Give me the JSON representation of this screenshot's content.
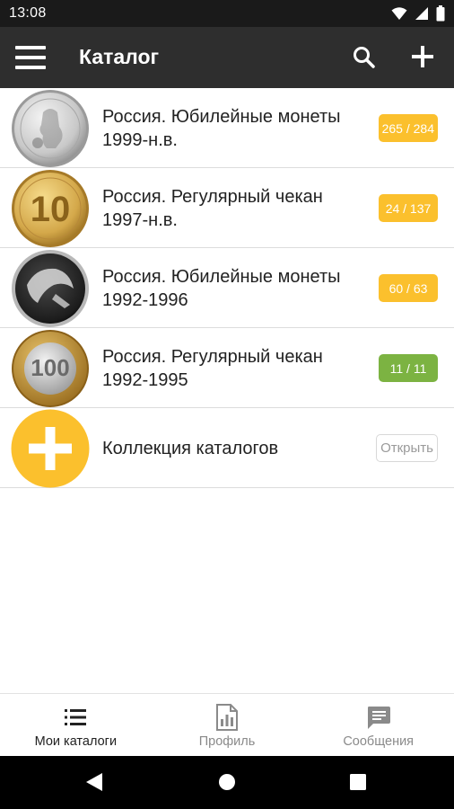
{
  "status_bar": {
    "time": "13:08",
    "icons": [
      "wifi-icon",
      "signal-icon",
      "battery-icon"
    ]
  },
  "app_bar": {
    "title": "Каталог",
    "icons": [
      "menu-icon",
      "search-icon",
      "add-icon"
    ]
  },
  "catalogs": [
    {
      "title": "Россия. Юбилейные монеты 1999-н.в.",
      "badge": "265 / 284",
      "badge_color": "#FBC02D",
      "coin": "silver-coin-icon"
    },
    {
      "title": "Россия. Регулярный чекан 1997-н.в.",
      "badge": "24 / 137",
      "badge_color": "#FBC02D",
      "coin": "gold-10-coin-icon",
      "coin_text": "10"
    },
    {
      "title": "Россия. Юбилейные монеты 1992-1996",
      "badge": "60 / 63",
      "badge_color": "#FBC02D",
      "coin": "black-commemorative-coin-icon"
    },
    {
      "title": "Россия. Регулярный чекан 1992-1995",
      "badge": "11 / 11",
      "badge_color": "#7CB342",
      "coin": "bimetal-100-coin-icon",
      "coin_text": "100"
    }
  ],
  "collection_row": {
    "title": "Коллекция каталогов",
    "button": "Открыть",
    "icon_color": "#FBC02D"
  },
  "bottom_nav": {
    "tabs": [
      {
        "label": "Мои каталоги",
        "icon": "list-icon",
        "active": true
      },
      {
        "label": "Профиль",
        "icon": "report-icon",
        "active": false
      },
      {
        "label": "Сообщения",
        "icon": "message-icon",
        "active": false
      }
    ]
  },
  "system_nav": [
    "back-icon",
    "home-icon",
    "recents-icon"
  ],
  "colors": {
    "app_bar": "#2E2E2E",
    "status_bar": "#1A1A1A",
    "accent_yellow": "#FBC02D",
    "complete_green": "#7CB342"
  }
}
